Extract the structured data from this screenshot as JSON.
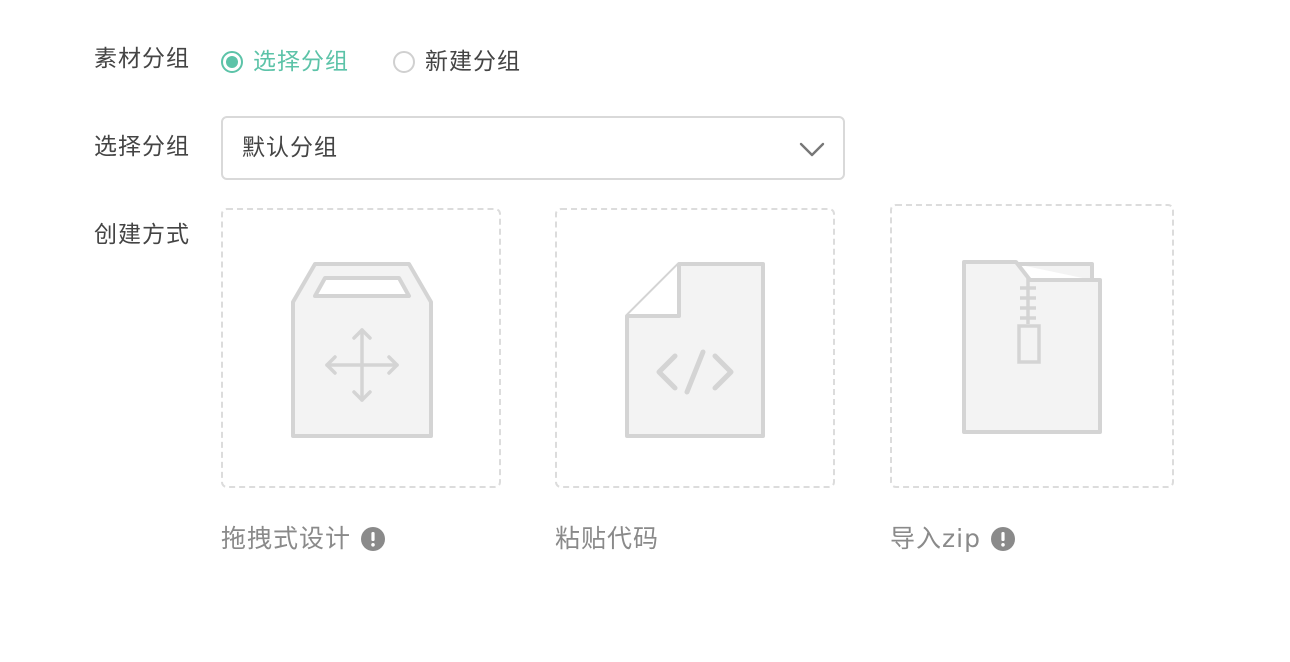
{
  "form": {
    "group_label": "素材分组",
    "radio_options": [
      {
        "label": "选择分组",
        "checked": true
      },
      {
        "label": "新建分组",
        "checked": false
      }
    ],
    "select_group_label": "选择分组",
    "select": {
      "value": "默认分组",
      "arrow_icon": "chevron-down-icon"
    },
    "create_method_label": "创建方式"
  },
  "methods": [
    {
      "label": "拖拽式设计",
      "icon": "drag-box-icon",
      "has_info": true
    },
    {
      "label": "粘贴代码",
      "icon": "code-file-icon",
      "has_info": false
    },
    {
      "label": "导入zip",
      "icon": "zip-file-icon",
      "has_info": true
    }
  ],
  "colors": {
    "accent": "#5cc3a8",
    "label_text": "#444444",
    "caption_text": "#8a8a8a",
    "card_border": "#dcdcdc",
    "icon_stroke": "#d4d4d4",
    "icon_fill": "#f3f3f3"
  }
}
